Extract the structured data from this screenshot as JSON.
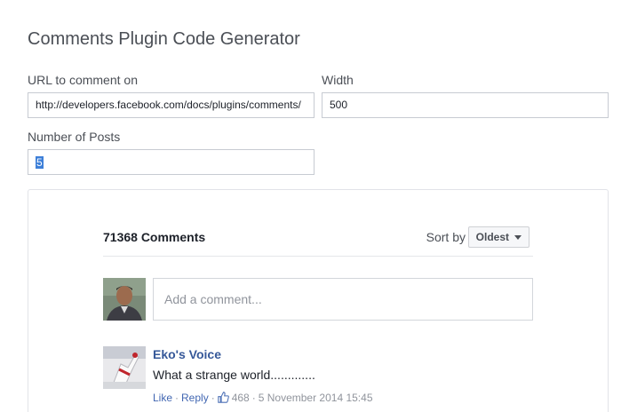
{
  "header": {
    "title": "Comments Plugin Code Generator"
  },
  "form": {
    "url": {
      "label": "URL to comment on",
      "value": "http://developers.facebook.com/docs/plugins/comments/"
    },
    "width": {
      "label": "Width",
      "value": "500"
    },
    "num_posts": {
      "label": "Number of Posts",
      "value": "5"
    }
  },
  "comments": {
    "count_label": "71368 Comments",
    "sort_label": "Sort by",
    "sort_value": "Oldest",
    "compose_placeholder": "Add a comment...",
    "items": [
      {
        "author": "Eko's Voice",
        "text": "What a strange world.............",
        "like_label": "Like",
        "reply_label": "Reply",
        "likes": "468",
        "timestamp": "5 November 2014 15:45"
      }
    ]
  },
  "colors": {
    "link": "#365899",
    "action_link": "#4267b2",
    "muted": "#90949c",
    "selection": "#3d7fd8"
  },
  "icons": {
    "like": "thumbs-up-icon",
    "sort": "caret-down-icon"
  }
}
